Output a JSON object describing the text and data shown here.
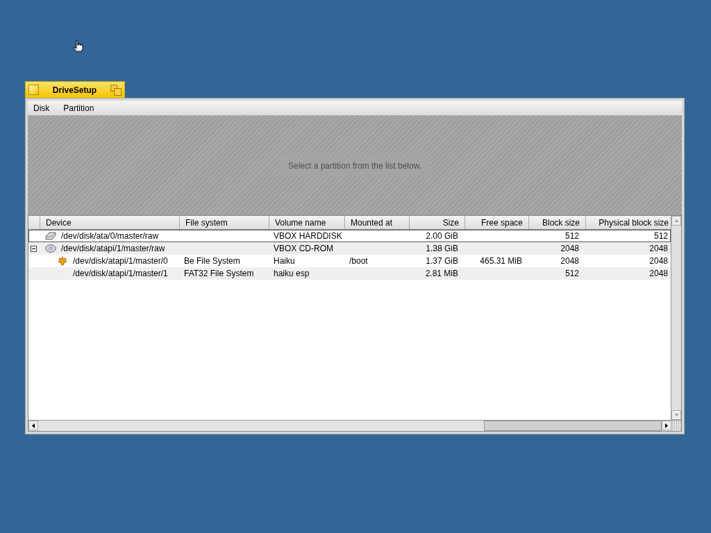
{
  "window": {
    "title": "DriveSetup"
  },
  "menu": [
    "Disk",
    "Partition"
  ],
  "disk_map": {
    "message": "Select a partition from the list below."
  },
  "table": {
    "columns": [
      "Device",
      "File system",
      "Volume name",
      "Mounted at",
      "Size",
      "Free space",
      "Block size",
      "Physical block size"
    ],
    "rows": [
      {
        "kind": "disk",
        "selected": true,
        "cells": [
          "/dev/disk/ata/0/master/raw",
          "",
          "VBOX HARDDISK",
          "",
          "2.00 GiB",
          "",
          "512",
          "512"
        ]
      },
      {
        "kind": "optical",
        "selected": false,
        "expanded": true,
        "cells": [
          "/dev/disk/atapi/1/master/raw",
          "",
          "VBOX CD-ROM",
          "",
          "1.38 GiB",
          "",
          "2048",
          "2048"
        ],
        "children": [
          {
            "kind": "bfs",
            "selected": false,
            "cells": [
              "/dev/disk/atapi/1/master/0",
              "Be File System",
              "Haiku",
              "/boot",
              "1.37 GiB",
              "465.31 MiB",
              "2048",
              "2048"
            ]
          },
          {
            "kind": "plain",
            "selected": false,
            "cells": [
              "/dev/disk/atapi/1/master/1",
              "FAT32 File System",
              "haiku esp",
              "",
              "2.81 MiB",
              "",
              "512",
              "2048"
            ]
          }
        ]
      }
    ]
  }
}
